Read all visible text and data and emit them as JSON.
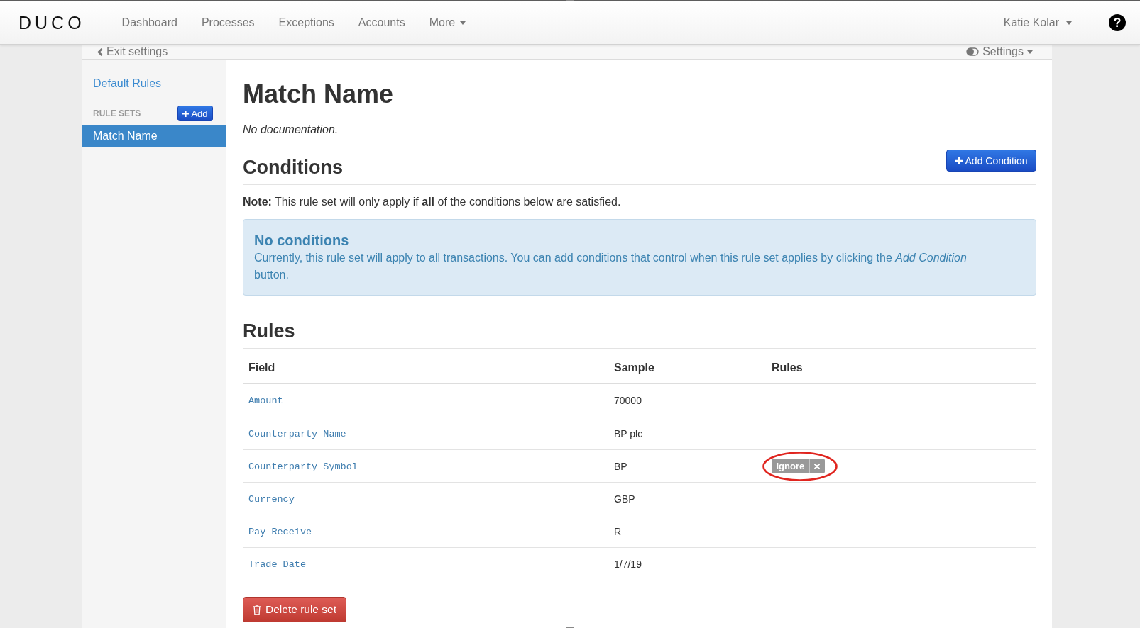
{
  "navbar": {
    "logo": "DUCO",
    "items": [
      {
        "label": "Dashboard",
        "kind": "link"
      },
      {
        "label": "Processes",
        "kind": "link"
      },
      {
        "label": "Exceptions",
        "kind": "link"
      },
      {
        "label": "Accounts",
        "kind": "link"
      },
      {
        "label": "More",
        "kind": "dropdown"
      }
    ],
    "user_menu": "Katie Kolar",
    "help": "?"
  },
  "settings_bar": {
    "exit": "Exit settings",
    "settings": "Settings"
  },
  "sidebar": {
    "default_rules": "Default Rules",
    "section_title": "RULE SETS",
    "add_button": "Add",
    "rule_sets": [
      {
        "label": "Match Name",
        "selected": true
      }
    ]
  },
  "main": {
    "title": "Match Name",
    "documentation": "No documentation.",
    "conditions": {
      "heading": "Conditions",
      "add_button": "Add Condition",
      "note": "**Note:** This rule set will only apply if **all** of the conditions below are satisfied.",
      "alert": {
        "title": "No conditions",
        "text": "Currently, this rule set will apply to all transactions. You can add conditions that control when this rule set applies by clicking the *Add Condition* button."
      }
    },
    "rules": {
      "heading": "Rules",
      "columns": [
        "Field",
        "Sample",
        "Rules"
      ],
      "rows": [
        {
          "field": "Amount",
          "sample": "70000"
        },
        {
          "field": "Counterparty Name",
          "sample": "BP plc"
        },
        {
          "field": "Counterparty Symbol",
          "sample": "BP",
          "rules": [
            {
              "label": "Ignore",
              "circled": true
            }
          ]
        },
        {
          "field": "Currency",
          "sample": "GBP"
        },
        {
          "field": "Pay Receive",
          "sample": "R"
        },
        {
          "field": "Trade Date",
          "sample": "1/7/19"
        }
      ]
    },
    "delete_button": "Delete rule set"
  }
}
